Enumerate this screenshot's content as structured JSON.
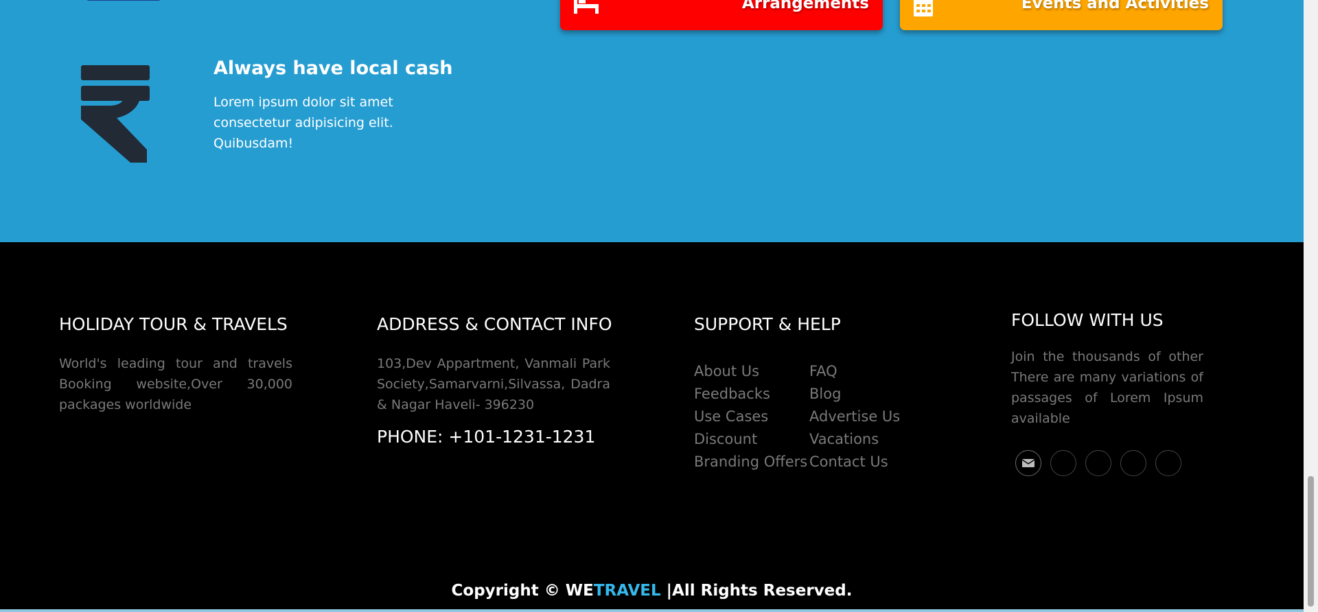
{
  "feature": {
    "title": "Always have local cash",
    "text": "Lorem ipsum dolor sit amet consectetur adipisicing elit. Quibusdam!",
    "icon": "rupee-icon"
  },
  "cta_buttons": [
    {
      "label": "Arrangements",
      "icon": "bed-icon",
      "color": "#ff0000"
    },
    {
      "label": "Events and Activities",
      "icon": "calendar-icon",
      "color": "#ffa500"
    }
  ],
  "footer": {
    "about": {
      "title": "HOLIDAY TOUR & TRAVELS",
      "text": "World's leading tour and travels Booking website,Over 30,000 packages worldwide"
    },
    "contact": {
      "title": "ADDRESS & CONTACT INFO",
      "address": "103,Dev Appartment, Vanmali Park Society,Samarvarni,Silvassa, Dadra & Nagar Haveli- 396230",
      "phone": "PHONE: +101-1231-1231"
    },
    "support": {
      "title": "SUPPORT & HELP",
      "links_left": [
        "About Us",
        "Feedbacks",
        "Use Cases",
        "Discount",
        "Branding Offers"
      ],
      "links_right": [
        "FAQ",
        "Blog",
        "Advertise Us",
        "Vacations",
        "Contact Us"
      ]
    },
    "follow": {
      "title": "FOLLOW WITH US",
      "text": "Join the thousands of other There are many variations of passages of Lorem Ipsum available",
      "social_icons": [
        "envelope-icon",
        "social-icon-2",
        "social-icon-3",
        "social-icon-4",
        "social-icon-5"
      ]
    }
  },
  "copyright": {
    "prefix": "Copyright © ",
    "brand_a": "WE",
    "brand_b": "TRAVEL",
    "suffix": " |All Rights Reserved."
  },
  "colors": {
    "band": "#269dd1",
    "footer_bg": "#000000",
    "brand_highlight": "#35b9ec",
    "muted_text": "#7a7a7a"
  }
}
